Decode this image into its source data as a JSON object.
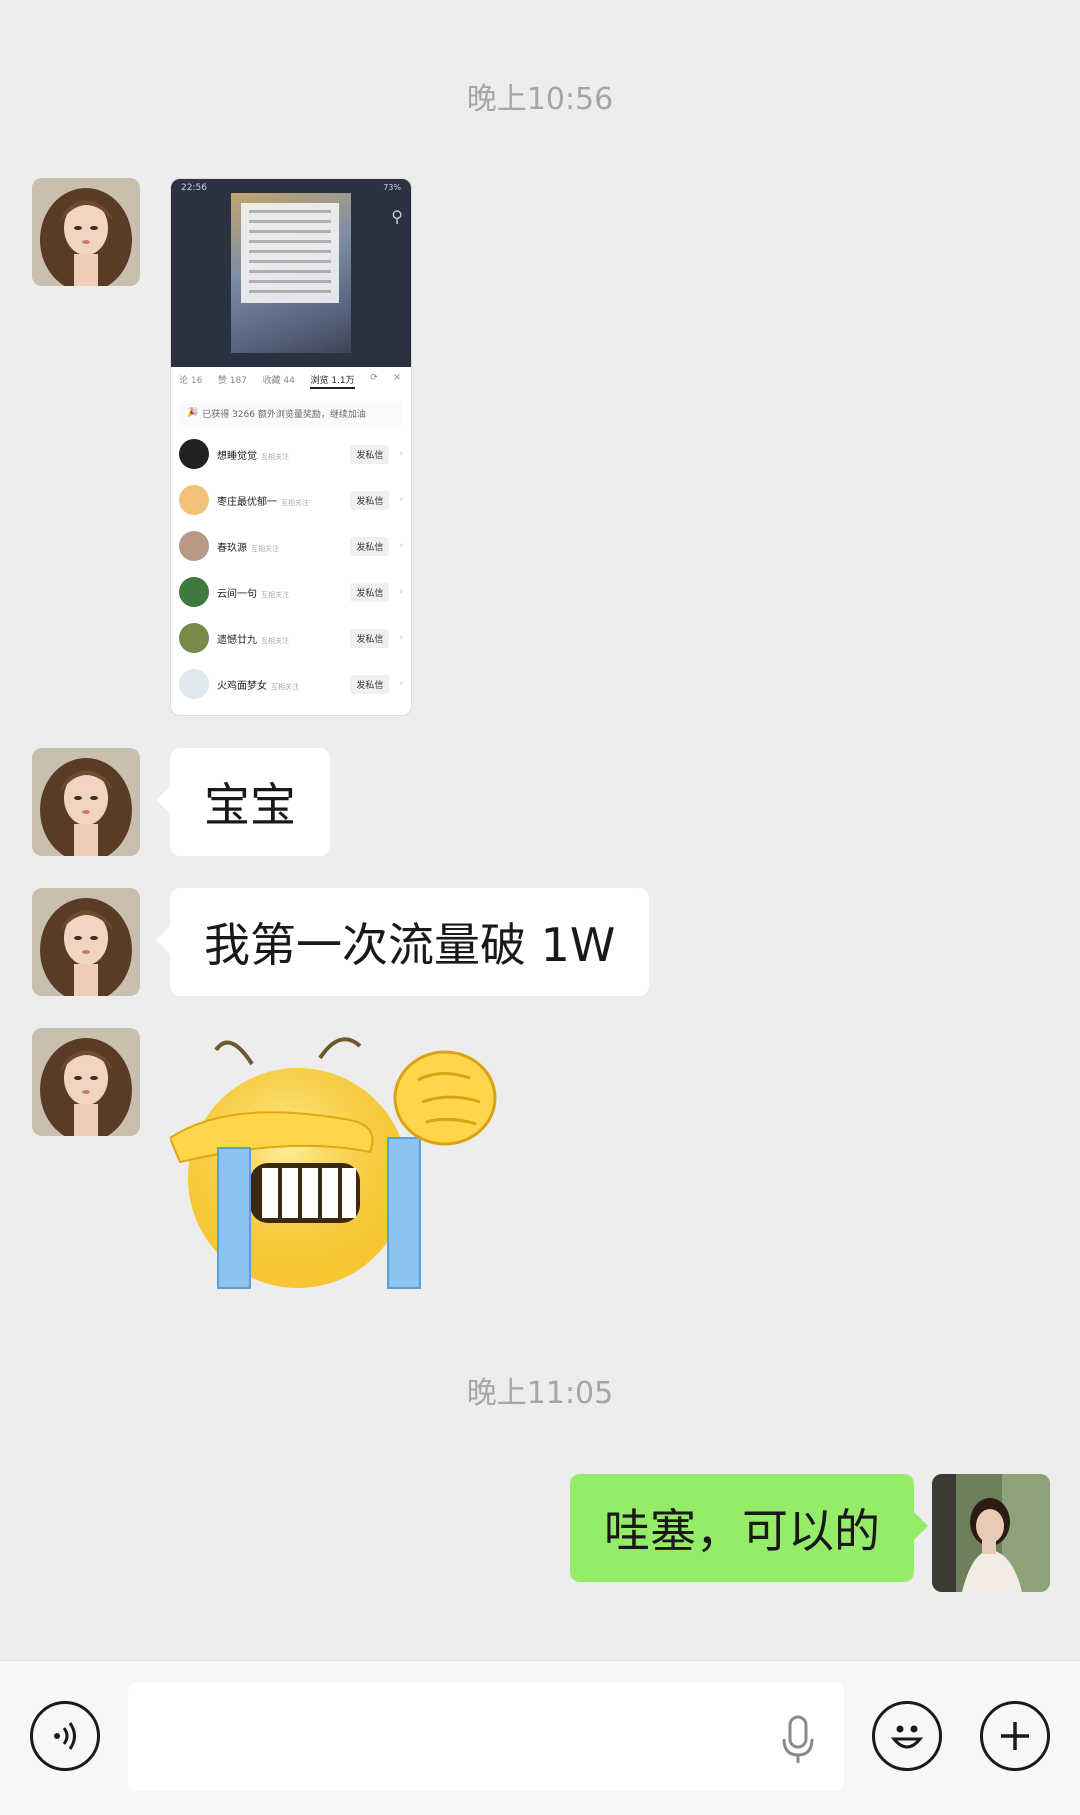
{
  "timestamps": [
    "晚上10:56",
    "晚上11:05"
  ],
  "messages": {
    "m1": "宝宝",
    "m2": "我第一次流量破 1W",
    "m3": "哇塞，可以的"
  },
  "screenshot": {
    "status_time": "22:56",
    "status_battery": "73%",
    "tabs": [
      "论 16",
      "赞 187",
      "收藏 44",
      "浏览 1.1万"
    ],
    "banner": "已获得 3266 额外浏览量奖励，继续加油",
    "action_label": "发私信",
    "users": [
      {
        "name": "想睡觉觉",
        "sub": "互相关注"
      },
      {
        "name": "枣庄最优郁一",
        "sub": "互相关注"
      },
      {
        "name": "春玖源",
        "sub": "互相关注"
      },
      {
        "name": "云间一句",
        "sub": "互相关注"
      },
      {
        "name": "遗憾廿九",
        "sub": "互相关注"
      },
      {
        "name": "火鸡面梦女",
        "sub": "互相关注"
      }
    ]
  },
  "icons": {
    "voice": "voice-toggle-icon",
    "mic": "microphone-icon",
    "emoji": "emoji-icon",
    "plus": "plus-icon"
  },
  "colors": {
    "sent_bubble": "#95ec69",
    "received_bubble": "#ffffff",
    "background": "#ededed"
  }
}
